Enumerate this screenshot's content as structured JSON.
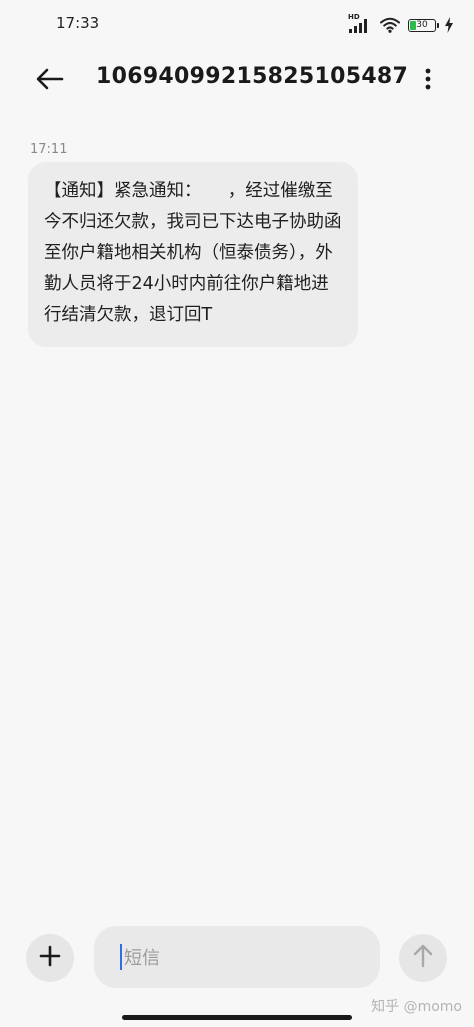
{
  "status_bar": {
    "time": "17:33",
    "network_label": "HD",
    "battery_level": "30",
    "battery_fraction": 0.3
  },
  "header": {
    "title": "10694099215825105487"
  },
  "messages": [
    {
      "timestamp": "17:11",
      "text": "【通知】紧急通知：　　，经过催缴至今不归还欠款，我司已下达电子协助函至你户籍地相关机构（恒泰债务），外勤人员将于24小时内前往你户籍地进行结清欠款，退订回T"
    }
  ],
  "composer": {
    "placeholder": "短信"
  },
  "watermark": "知乎 @momo",
  "colors": {
    "background": "#f7f7f7",
    "bubble": "#ececec",
    "caret": "#2f6fe0",
    "battery_fill": "#2dbb4e"
  }
}
